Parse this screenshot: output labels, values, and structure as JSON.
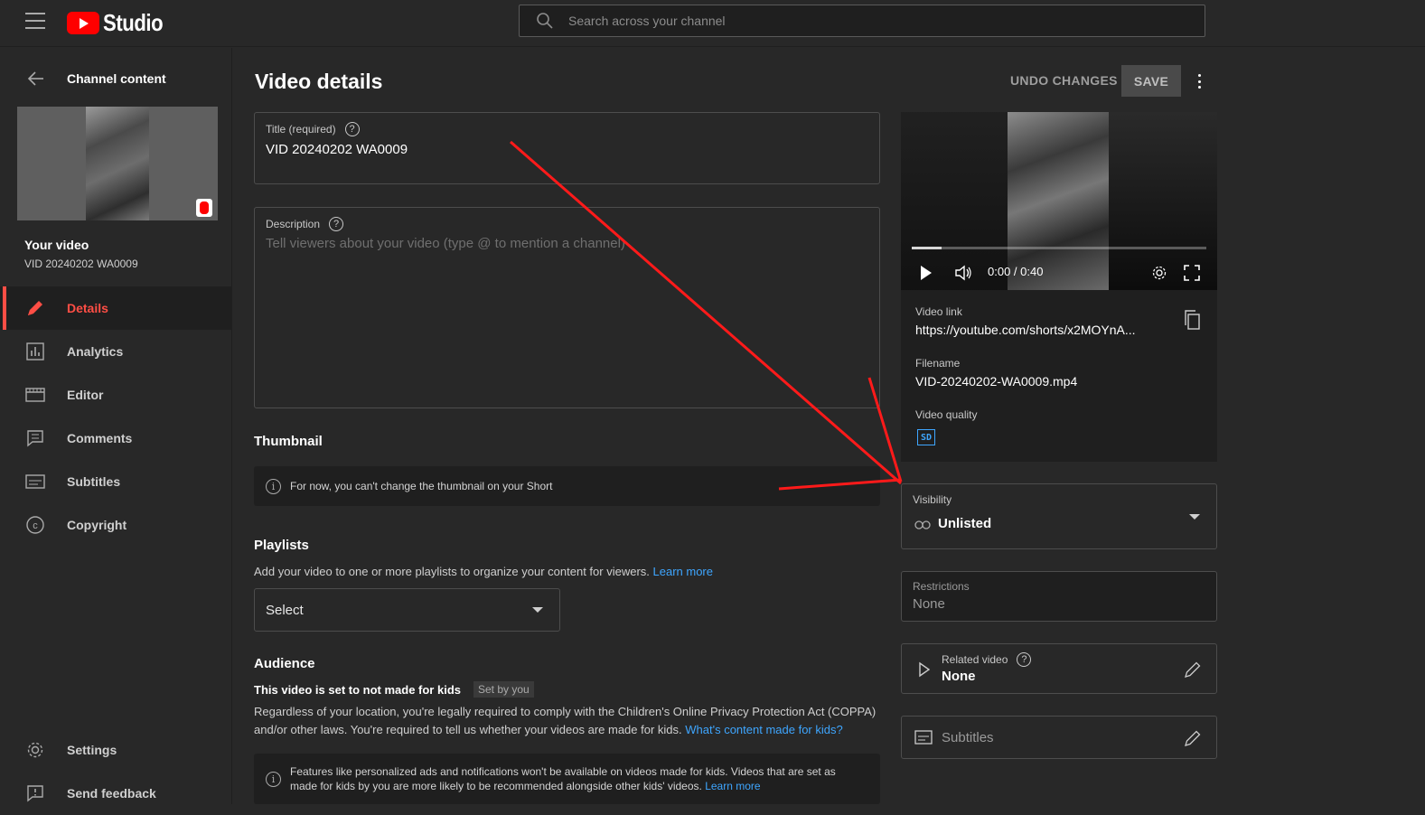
{
  "header": {
    "app_name": "Studio",
    "search_placeholder": "Search across your channel"
  },
  "sidebar": {
    "back_label": "Channel content",
    "your_video_label": "Your video",
    "video_name": "VID 20240202 WA0009",
    "items": [
      {
        "label": "Details",
        "icon": "pencil-icon",
        "active": true
      },
      {
        "label": "Analytics",
        "icon": "analytics-icon"
      },
      {
        "label": "Editor",
        "icon": "editor-icon"
      },
      {
        "label": "Comments",
        "icon": "comments-icon"
      },
      {
        "label": "Subtitles",
        "icon": "subtitles-icon"
      },
      {
        "label": "Copyright",
        "icon": "copyright-icon"
      }
    ],
    "bottom_items": [
      {
        "label": "Settings",
        "icon": "gear-icon"
      },
      {
        "label": "Send feedback",
        "icon": "feedback-icon"
      }
    ]
  },
  "main": {
    "page_title": "Video details",
    "undo_label": "UNDO CHANGES",
    "save_label": "SAVE",
    "title_field": {
      "label": "Title (required)",
      "value": "VID 20240202 WA0009"
    },
    "description_field": {
      "label": "Description",
      "placeholder": "Tell viewers about your video (type @ to mention a channel)"
    },
    "thumbnail": {
      "heading": "Thumbnail",
      "info": "For now, you can't change the thumbnail on your Short"
    },
    "playlists": {
      "heading": "Playlists",
      "text": "Add your video to one or more playlists to organize your content for viewers.",
      "learn_more": "Learn more",
      "select_value": "Select"
    },
    "audience": {
      "heading": "Audience",
      "status": "This video is set to not made for kids",
      "tag": "Set by you",
      "text_1": "Regardless of your location, you're legally required to comply with the Children's Online Privacy Protection Act (COPPA)",
      "text_2": "and/or other laws. You're required to tell us whether your videos are made for kids.",
      "link": "What's content made for kids?",
      "info_1": "Features like personalized ads and notifications won't be available on videos made for kids. Videos that are set as",
      "info_2": "made for kids by you are more likely to be recommended alongside other kids' videos.",
      "info_link": "Learn more"
    }
  },
  "right_panel": {
    "player": {
      "time": "0:00 / 0:40",
      "progress": 0.1
    },
    "video_link_label": "Video link",
    "video_link": "https://youtube.com/shorts/x2MOYnA...",
    "filename_label": "Filename",
    "filename": "VID-20240202-WA0009.mp4",
    "quality_label": "Video quality",
    "quality_badge": "SD",
    "visibility_label": "Visibility",
    "visibility_value": "Unlisted",
    "restrictions_label": "Restrictions",
    "restrictions_value": "None",
    "related_label": "Related video",
    "related_value": "None",
    "subtitles_label": "Subtitles"
  },
  "colors": {
    "accent_red": "#ff4e45",
    "link_blue": "#3ea6ff",
    "annotation_arrow": "#ff1a1a"
  }
}
